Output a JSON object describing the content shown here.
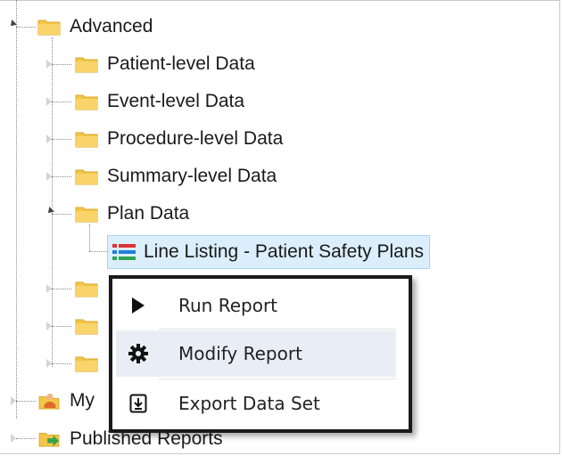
{
  "tree": {
    "root": {
      "label": "Advanced",
      "icon": "folder-icon",
      "expanded": true
    },
    "children": [
      {
        "label": "Patient-level Data",
        "icon": "folder-icon",
        "expanded": false
      },
      {
        "label": "Event-level Data",
        "icon": "folder-icon",
        "expanded": false
      },
      {
        "label": "Procedure-level Data",
        "icon": "folder-icon",
        "expanded": false
      },
      {
        "label": "Summary-level Data",
        "icon": "folder-icon",
        "expanded": false
      },
      {
        "label": "Plan Data",
        "icon": "folder-icon",
        "expanded": true
      }
    ],
    "report": {
      "label": "Line Listing - Patient Safety Plans",
      "icon": "line-listing-icon",
      "selected": true
    },
    "lower": [
      {
        "label": "My",
        "icon": "my-reports-icon"
      },
      {
        "label": "Published Reports",
        "icon": "published-reports-icon"
      }
    ]
  },
  "context_menu": {
    "items": [
      {
        "label": "Run Report",
        "icon": "play-icon"
      },
      {
        "label": "Modify Report",
        "icon": "gear-icon",
        "highlighted": true
      },
      {
        "label": "Export Data Set",
        "icon": "export-icon"
      }
    ]
  },
  "colors": {
    "folder": "#f3c54a",
    "selected_bg": "#dbeefb",
    "menu_hover": "#e9eef6",
    "menu_border": "#1a1a1a"
  }
}
